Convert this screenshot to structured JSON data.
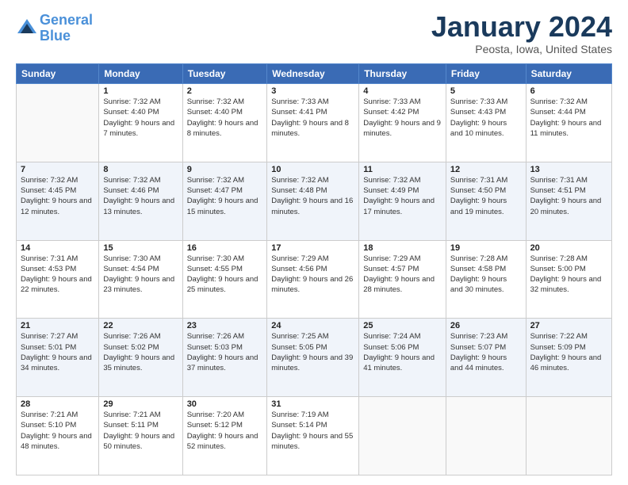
{
  "header": {
    "logo_line1": "General",
    "logo_line2": "Blue",
    "month_title": "January 2024",
    "location": "Peosta, Iowa, United States"
  },
  "days_of_week": [
    "Sunday",
    "Monday",
    "Tuesday",
    "Wednesday",
    "Thursday",
    "Friday",
    "Saturday"
  ],
  "weeks": [
    [
      {
        "day": "",
        "sunrise": "",
        "sunset": "",
        "daylight": ""
      },
      {
        "day": "1",
        "sunrise": "Sunrise: 7:32 AM",
        "sunset": "Sunset: 4:40 PM",
        "daylight": "Daylight: 9 hours and 7 minutes."
      },
      {
        "day": "2",
        "sunrise": "Sunrise: 7:32 AM",
        "sunset": "Sunset: 4:40 PM",
        "daylight": "Daylight: 9 hours and 8 minutes."
      },
      {
        "day": "3",
        "sunrise": "Sunrise: 7:33 AM",
        "sunset": "Sunset: 4:41 PM",
        "daylight": "Daylight: 9 hours and 8 minutes."
      },
      {
        "day": "4",
        "sunrise": "Sunrise: 7:33 AM",
        "sunset": "Sunset: 4:42 PM",
        "daylight": "Daylight: 9 hours and 9 minutes."
      },
      {
        "day": "5",
        "sunrise": "Sunrise: 7:33 AM",
        "sunset": "Sunset: 4:43 PM",
        "daylight": "Daylight: 9 hours and 10 minutes."
      },
      {
        "day": "6",
        "sunrise": "Sunrise: 7:32 AM",
        "sunset": "Sunset: 4:44 PM",
        "daylight": "Daylight: 9 hours and 11 minutes."
      }
    ],
    [
      {
        "day": "7",
        "sunrise": "Sunrise: 7:32 AM",
        "sunset": "Sunset: 4:45 PM",
        "daylight": "Daylight: 9 hours and 12 minutes."
      },
      {
        "day": "8",
        "sunrise": "Sunrise: 7:32 AM",
        "sunset": "Sunset: 4:46 PM",
        "daylight": "Daylight: 9 hours and 13 minutes."
      },
      {
        "day": "9",
        "sunrise": "Sunrise: 7:32 AM",
        "sunset": "Sunset: 4:47 PM",
        "daylight": "Daylight: 9 hours and 15 minutes."
      },
      {
        "day": "10",
        "sunrise": "Sunrise: 7:32 AM",
        "sunset": "Sunset: 4:48 PM",
        "daylight": "Daylight: 9 hours and 16 minutes."
      },
      {
        "day": "11",
        "sunrise": "Sunrise: 7:32 AM",
        "sunset": "Sunset: 4:49 PM",
        "daylight": "Daylight: 9 hours and 17 minutes."
      },
      {
        "day": "12",
        "sunrise": "Sunrise: 7:31 AM",
        "sunset": "Sunset: 4:50 PM",
        "daylight": "Daylight: 9 hours and 19 minutes."
      },
      {
        "day": "13",
        "sunrise": "Sunrise: 7:31 AM",
        "sunset": "Sunset: 4:51 PM",
        "daylight": "Daylight: 9 hours and 20 minutes."
      }
    ],
    [
      {
        "day": "14",
        "sunrise": "Sunrise: 7:31 AM",
        "sunset": "Sunset: 4:53 PM",
        "daylight": "Daylight: 9 hours and 22 minutes."
      },
      {
        "day": "15",
        "sunrise": "Sunrise: 7:30 AM",
        "sunset": "Sunset: 4:54 PM",
        "daylight": "Daylight: 9 hours and 23 minutes."
      },
      {
        "day": "16",
        "sunrise": "Sunrise: 7:30 AM",
        "sunset": "Sunset: 4:55 PM",
        "daylight": "Daylight: 9 hours and 25 minutes."
      },
      {
        "day": "17",
        "sunrise": "Sunrise: 7:29 AM",
        "sunset": "Sunset: 4:56 PM",
        "daylight": "Daylight: 9 hours and 26 minutes."
      },
      {
        "day": "18",
        "sunrise": "Sunrise: 7:29 AM",
        "sunset": "Sunset: 4:57 PM",
        "daylight": "Daylight: 9 hours and 28 minutes."
      },
      {
        "day": "19",
        "sunrise": "Sunrise: 7:28 AM",
        "sunset": "Sunset: 4:58 PM",
        "daylight": "Daylight: 9 hours and 30 minutes."
      },
      {
        "day": "20",
        "sunrise": "Sunrise: 7:28 AM",
        "sunset": "Sunset: 5:00 PM",
        "daylight": "Daylight: 9 hours and 32 minutes."
      }
    ],
    [
      {
        "day": "21",
        "sunrise": "Sunrise: 7:27 AM",
        "sunset": "Sunset: 5:01 PM",
        "daylight": "Daylight: 9 hours and 34 minutes."
      },
      {
        "day": "22",
        "sunrise": "Sunrise: 7:26 AM",
        "sunset": "Sunset: 5:02 PM",
        "daylight": "Daylight: 9 hours and 35 minutes."
      },
      {
        "day": "23",
        "sunrise": "Sunrise: 7:26 AM",
        "sunset": "Sunset: 5:03 PM",
        "daylight": "Daylight: 9 hours and 37 minutes."
      },
      {
        "day": "24",
        "sunrise": "Sunrise: 7:25 AM",
        "sunset": "Sunset: 5:05 PM",
        "daylight": "Daylight: 9 hours and 39 minutes."
      },
      {
        "day": "25",
        "sunrise": "Sunrise: 7:24 AM",
        "sunset": "Sunset: 5:06 PM",
        "daylight": "Daylight: 9 hours and 41 minutes."
      },
      {
        "day": "26",
        "sunrise": "Sunrise: 7:23 AM",
        "sunset": "Sunset: 5:07 PM",
        "daylight": "Daylight: 9 hours and 44 minutes."
      },
      {
        "day": "27",
        "sunrise": "Sunrise: 7:22 AM",
        "sunset": "Sunset: 5:09 PM",
        "daylight": "Daylight: 9 hours and 46 minutes."
      }
    ],
    [
      {
        "day": "28",
        "sunrise": "Sunrise: 7:21 AM",
        "sunset": "Sunset: 5:10 PM",
        "daylight": "Daylight: 9 hours and 48 minutes."
      },
      {
        "day": "29",
        "sunrise": "Sunrise: 7:21 AM",
        "sunset": "Sunset: 5:11 PM",
        "daylight": "Daylight: 9 hours and 50 minutes."
      },
      {
        "day": "30",
        "sunrise": "Sunrise: 7:20 AM",
        "sunset": "Sunset: 5:12 PM",
        "daylight": "Daylight: 9 hours and 52 minutes."
      },
      {
        "day": "31",
        "sunrise": "Sunrise: 7:19 AM",
        "sunset": "Sunset: 5:14 PM",
        "daylight": "Daylight: 9 hours and 55 minutes."
      },
      {
        "day": "",
        "sunrise": "",
        "sunset": "",
        "daylight": ""
      },
      {
        "day": "",
        "sunrise": "",
        "sunset": "",
        "daylight": ""
      },
      {
        "day": "",
        "sunrise": "",
        "sunset": "",
        "daylight": ""
      }
    ]
  ]
}
